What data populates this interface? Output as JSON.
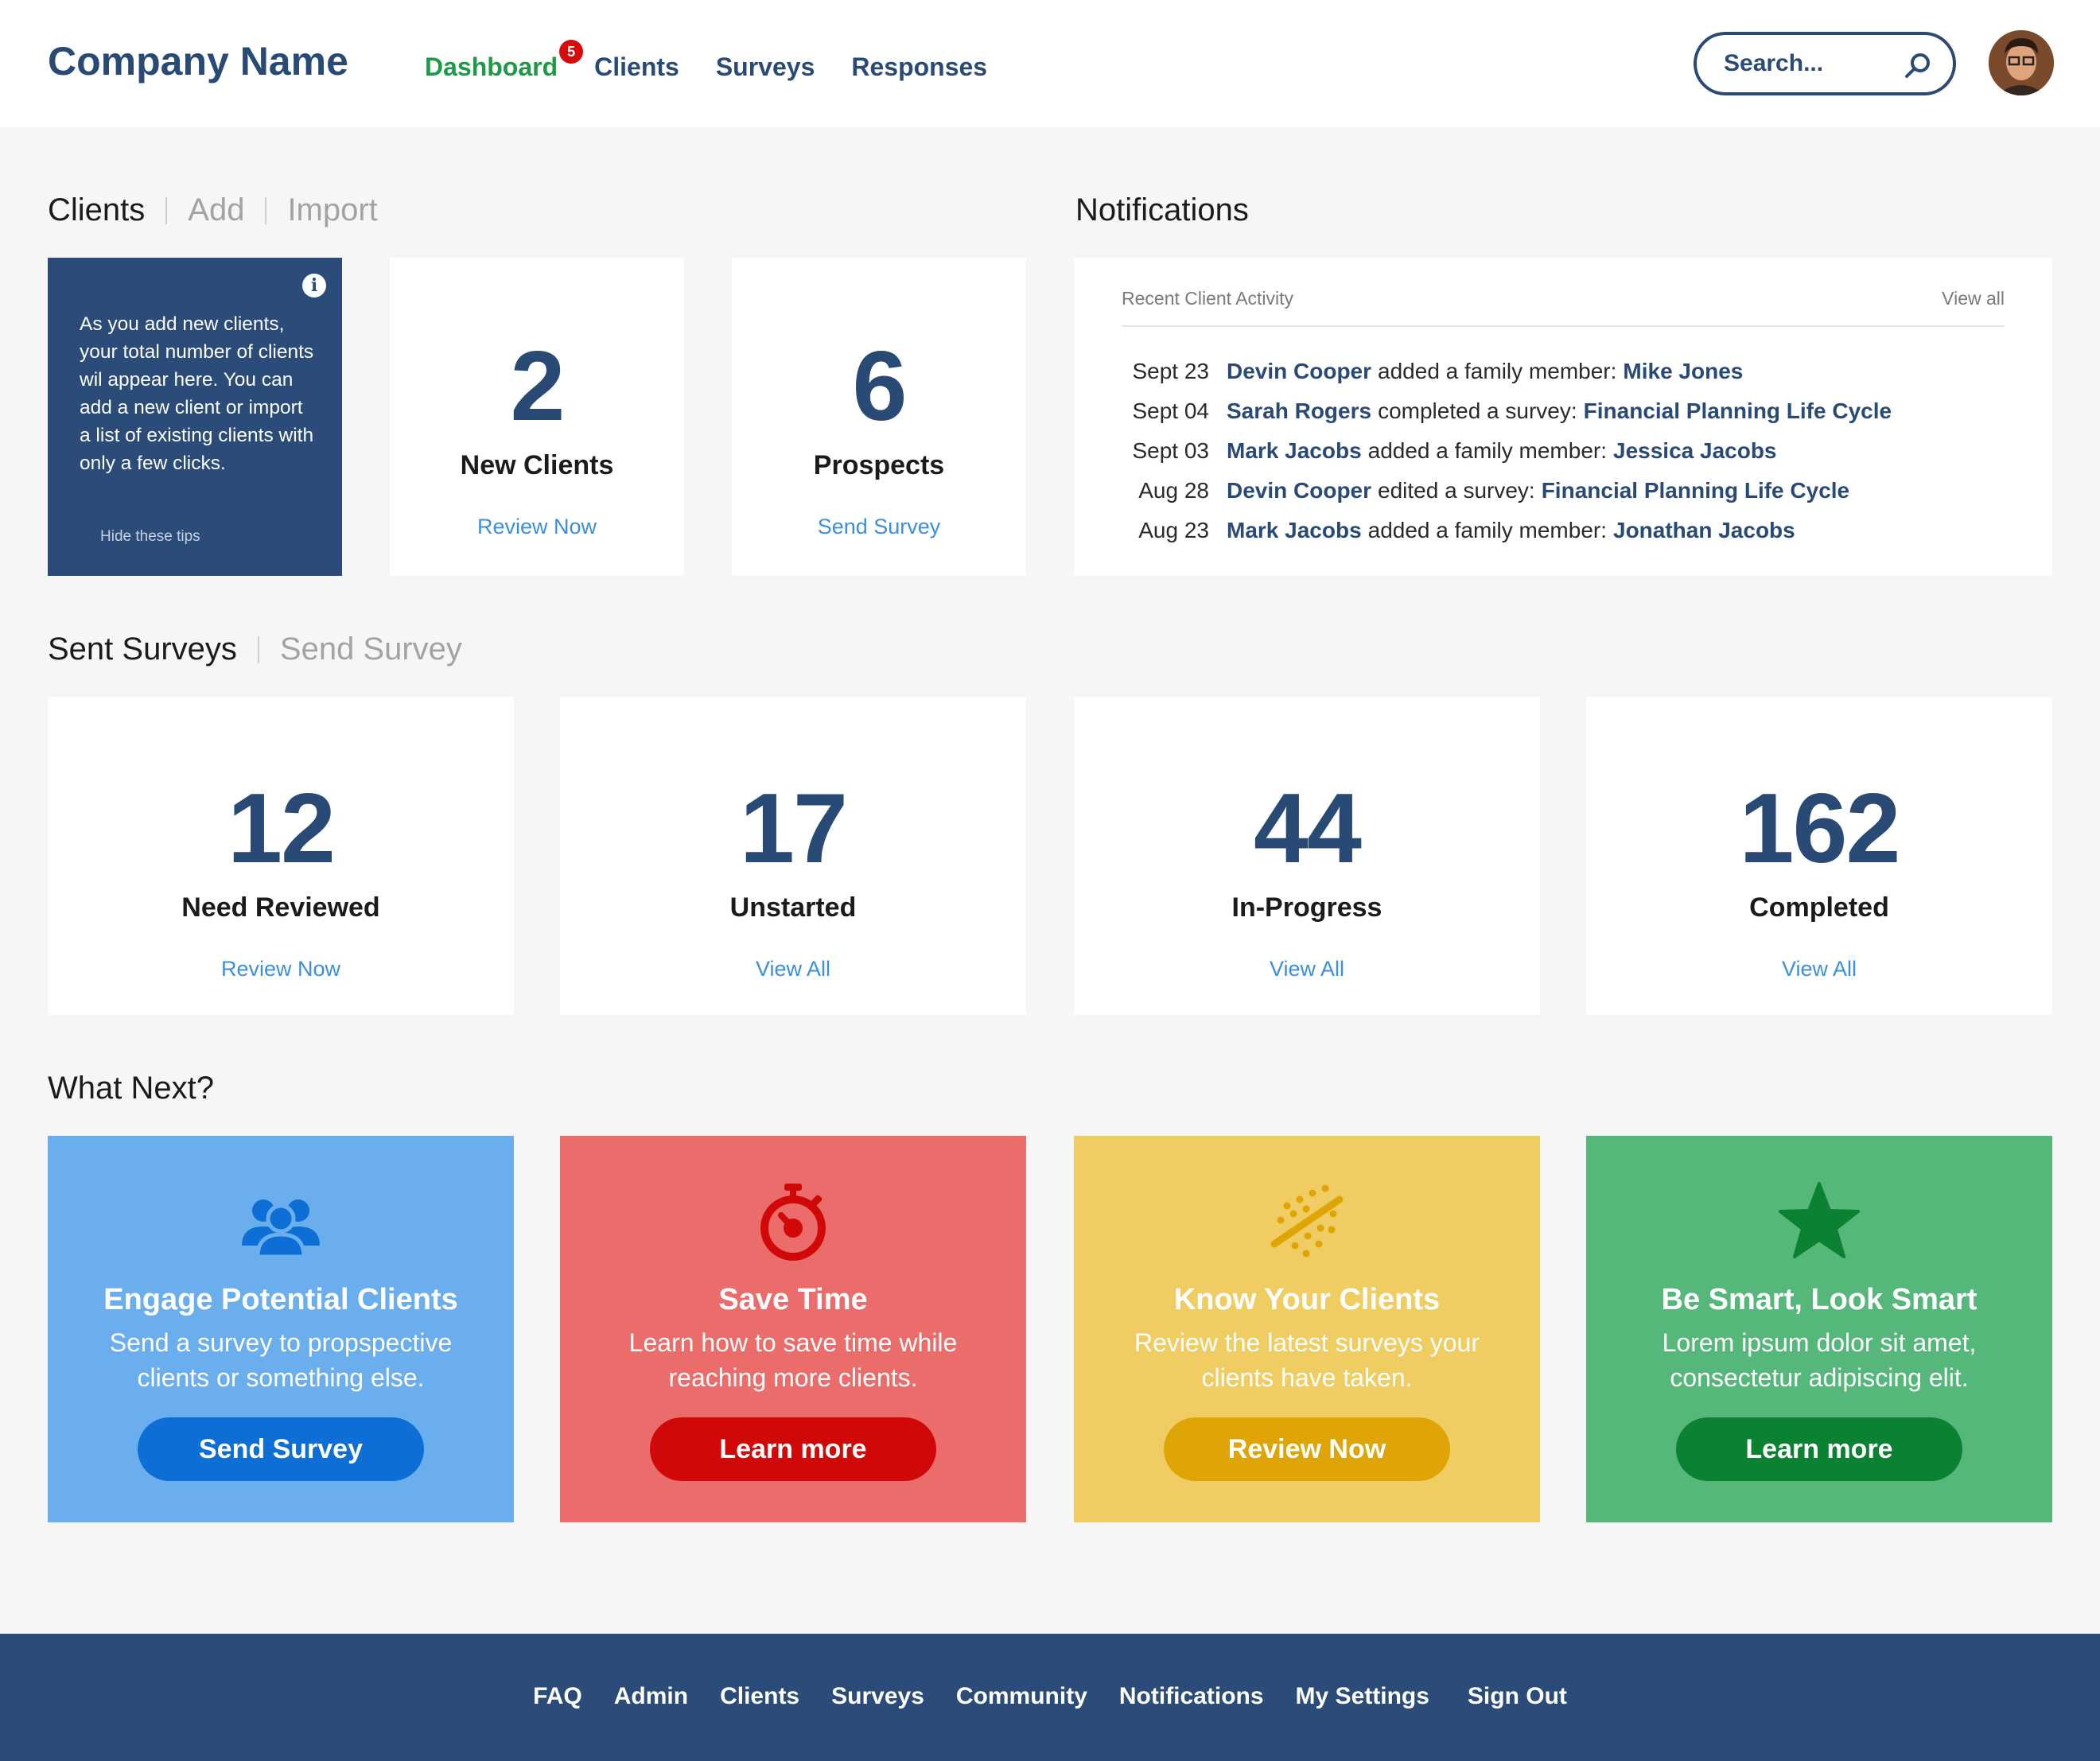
{
  "brand": "Company Name",
  "nav": {
    "dashboard": "Dashboard",
    "dashboard_badge": "5",
    "clients": "Clients",
    "surveys": "Surveys",
    "responses": "Responses"
  },
  "search": {
    "placeholder": "Search..."
  },
  "clients_section": {
    "title": "Clients",
    "add": "Add",
    "import": "Import"
  },
  "tip": {
    "text": "As you add new clients, your total number of clients wil appear here. You can add a new client or import a list of existing clients with only a few clicks.",
    "hide": "Hide these tips"
  },
  "client_cards": [
    {
      "value": "2",
      "label": "New Clients",
      "link": "Review Now"
    },
    {
      "value": "6",
      "label": "Prospects",
      "link": "Send Survey"
    }
  ],
  "notifications": {
    "title": "Notifications",
    "subtitle": "Recent Client Activity",
    "view_all": "View all",
    "items": [
      {
        "date": "Sept 23",
        "name": "Devin Cooper",
        "action": "added a family member:",
        "target": "Mike Jones"
      },
      {
        "date": "Sept 04",
        "name": "Sarah Rogers",
        "action": "completed a survey:",
        "target": "Financial Planning Life Cycle"
      },
      {
        "date": "Sept 03",
        "name": "Mark Jacobs",
        "action": "added a family member:",
        "target": "Jessica Jacobs"
      },
      {
        "date": "Aug 28",
        "name": "Devin Cooper",
        "action": "edited a survey:",
        "target": "Financial Planning Life Cycle"
      },
      {
        "date": "Aug 23",
        "name": "Mark Jacobs",
        "action": "added a family member:",
        "target": "Jonathan Jacobs"
      }
    ]
  },
  "surveys_section": {
    "title": "Sent Surveys",
    "send": "Send Survey"
  },
  "survey_cards": [
    {
      "value": "12",
      "label": "Need Reviewed",
      "link": "Review Now"
    },
    {
      "value": "17",
      "label": "Unstarted",
      "link": "View All"
    },
    {
      "value": "44",
      "label": "In-Progress",
      "link": "View All"
    },
    {
      "value": "162",
      "label": "Completed",
      "link": "View All"
    }
  ],
  "what_next": {
    "title": "What Next?",
    "cards": [
      {
        "icon": "users-icon",
        "title": "Engage Potential Clients",
        "desc1": "Send a survey to propspective",
        "desc2": "clients or something else.",
        "button": "Send Survey",
        "bg": "#6aaeed",
        "btn": "#0d6fd6"
      },
      {
        "icon": "stopwatch-icon",
        "title": "Save Time",
        "desc1": "Learn how to save time while",
        "desc2": "reaching more clients.",
        "button": "Learn more",
        "bg": "#ea6c6b",
        "btn": "#d10808"
      },
      {
        "icon": "magic-wand-icon",
        "title": "Know Your Clients",
        "desc1": "Review the latest surveys your",
        "desc2": "clients have taken.",
        "button": "Review Now",
        "bg": "#f0cd63",
        "btn": "#dfa406"
      },
      {
        "icon": "star-icon",
        "title": "Be Smart, Look Smart",
        "desc1": "Lorem ipsum dolor sit amet,",
        "desc2": "consectetur adipiscing elit.",
        "button": "Learn more",
        "bg": "#56b77b",
        "btn": "#0b8232"
      }
    ]
  },
  "footer": [
    "FAQ",
    "Admin",
    "Clients",
    "Surveys",
    "Community",
    "Notifications",
    "My Settings",
    "Sign Out"
  ]
}
